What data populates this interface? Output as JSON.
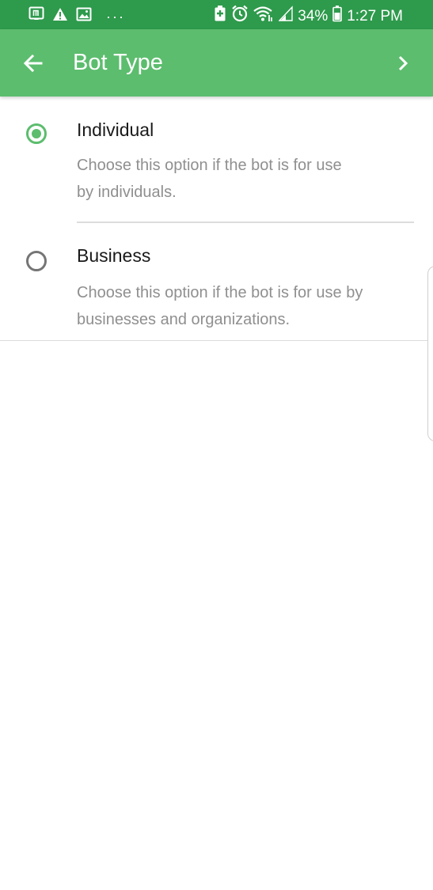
{
  "status_bar": {
    "battery": "34%",
    "time": "1:27 PM",
    "left_icons": [
      "notification-n-icon",
      "warning-icon",
      "image-icon",
      "more-dots-icon"
    ],
    "right_icons": [
      "battery-saver-icon",
      "alarm-icon",
      "wifi-icon",
      "signal-icon",
      "battery-icon"
    ]
  },
  "app_bar": {
    "title": "Bot Type",
    "back_icon": "arrow-back-icon",
    "next_icon": "chevron-right-icon"
  },
  "options": [
    {
      "title": "Individual",
      "description_line1": "Choose this option if the bot is for use",
      "description_line2": "by individuals.",
      "selected": true
    },
    {
      "title": "Business",
      "description_line1": "Choose this option if the bot is for use by",
      "description_line2": "businesses and organizations.",
      "selected": false
    }
  ],
  "colors": {
    "status_bar": "#2e9a4c",
    "app_bar": "#5cbd6e",
    "accent": "#5cbd6e",
    "description_text": "#8f8f8f"
  }
}
